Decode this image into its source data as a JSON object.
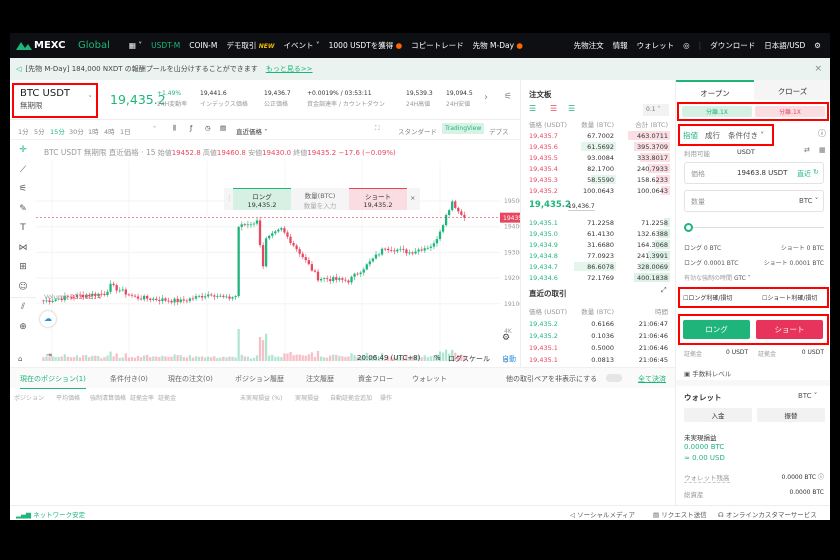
{
  "nav": {
    "logo_main": "MEXC",
    "logo_sub": "Global",
    "items": [
      "USDT-M",
      "COIN-M",
      "デモ取引",
      "イベント",
      "1000 USDTを獲得",
      "コピートレード",
      "先物 M-Day"
    ],
    "new_badge": "NEW",
    "right": [
      "先物注文",
      "情報",
      "ウォレット",
      "ダウンロード",
      "日本語/USD"
    ]
  },
  "banner": {
    "text": "[先物 M-Day] 184,000 NXDT の報酬プールを山分けすることができます",
    "link": "もっと見る>>"
  },
  "ticker": {
    "symbol": "BTC USDT",
    "type": "無期限",
    "price": "19,435.2",
    "stats": [
      {
        "v": "+1.49%",
        "l": "24H変動率"
      },
      {
        "v": "19,441.6",
        "l": "インデックス価格"
      },
      {
        "v": "19,436.7",
        "l": "公正価格"
      },
      {
        "v": "+0.0019% / 03:53:11",
        "l": "資金調達率 / カウントダウン"
      },
      {
        "v": "19,539.3",
        "l": "24H高値"
      },
      {
        "v": "19,094.5",
        "l": "24H安値"
      }
    ]
  },
  "chart": {
    "intervals": [
      "1分",
      "5分",
      "15分",
      "30分",
      "1時",
      "4時",
      "1日"
    ],
    "active_interval": "15分",
    "price_type": "直近価格",
    "views": [
      "スタンダード",
      "TradingView",
      "デプス"
    ],
    "active_view": "TradingView",
    "legend": {
      "title": "BTC USDT 無期限 直近価格 · 15",
      "open_l": "始値",
      "open": "19452.8",
      "high_l": "高値",
      "high": "19460.8",
      "low_l": "安値",
      "low": "19430.0",
      "close_l": "終値",
      "close": "19435.2",
      "change": "−17.6 (−0.09%)"
    },
    "quick_order": {
      "long": "ロング",
      "long_price": "19,435.2",
      "qty_label": "数量(BTC)",
      "qty_placeholder": "数量を入力",
      "short": "ショート",
      "short_price": "19,435.2"
    },
    "price_ticks": [
      "19500.0",
      "19400.0",
      "19300.0",
      "19200.0",
      "19100.0"
    ],
    "last_price_tag": "19435.2",
    "volume_label": "Volume",
    "volume_value": "233.8574",
    "volume_ticks": [
      "4K",
      "0"
    ],
    "time_ticks": [
      ":00",
      "18:00",
      "17",
      "06:00",
      "12:00",
      "18:00",
      "22:00"
    ],
    "price_path": [
      [
        0,
        19110
      ],
      [
        10,
        19130
      ],
      [
        20,
        19140
      ],
      [
        22,
        19170
      ],
      [
        30,
        19125
      ],
      [
        45,
        19110
      ],
      [
        55,
        19140
      ],
      [
        60,
        19120
      ],
      [
        63,
        19130
      ],
      [
        64,
        19400
      ],
      [
        70,
        19420
      ],
      [
        72,
        19250
      ],
      [
        73,
        19350
      ],
      [
        78,
        19390
      ],
      [
        84,
        19300
      ],
      [
        90,
        19200
      ],
      [
        100,
        19190
      ],
      [
        106,
        19250
      ],
      [
        112,
        19320
      ],
      [
        120,
        19300
      ],
      [
        128,
        19330
      ],
      [
        134,
        19500
      ],
      [
        136,
        19460
      ],
      [
        138,
        19435.2
      ]
    ],
    "clock": "20:06:49 (UTC+8)",
    "pct": "%",
    "log": "ログスケール",
    "auto": "自動"
  },
  "positions": {
    "tabs": [
      "現在のポジション(1)",
      "条件付き(0)",
      "現在の注文(0)",
      "ポジション履歴",
      "注文履歴",
      "資金フロー",
      "ウォレット"
    ],
    "hide_pairs": "他の取引ペアを非表示にする",
    "close_all": "全て決済",
    "columns": [
      "ポジション",
      "平均価格",
      "強制清算価格",
      "証拠金率",
      "証拠金",
      "未実現損益 (%)",
      "実現損益",
      "自動証拠金追加",
      "操作"
    ]
  },
  "orderbook": {
    "title": "注文板",
    "precision": "0.1",
    "headers": [
      "価格 (USDT)",
      "数量 (BTC)",
      "合計 (BTC)"
    ],
    "asks": [
      [
        "19,435.7",
        "67.7002",
        "463.0711"
      ],
      [
        "19,435.6",
        "61.5692",
        "395.3709"
      ],
      [
        "19,435.5",
        "93.0084",
        "333.8017"
      ],
      [
        "19,435.4",
        "82.1700",
        "240.7933"
      ],
      [
        "19,435.3",
        "58.5590",
        "158.6233"
      ],
      [
        "19,435.2",
        "100.0643",
        "100.0643"
      ]
    ],
    "mid": "19,435.2",
    "mark": "19,436.7",
    "bids": [
      [
        "19,435.1",
        "71.2258",
        "71.2258"
      ],
      [
        "19,435.0",
        "61.4130",
        "132.6388"
      ],
      [
        "19,434.9",
        "31.6680",
        "164.3068"
      ],
      [
        "19,434.8",
        "77.0923",
        "241.3991"
      ],
      [
        "19,434.7",
        "86.6078",
        "328.0069"
      ],
      [
        "19,434.6",
        "72.1769",
        "400.1838"
      ]
    ]
  },
  "trades": {
    "title": "直近の取引",
    "headers": [
      "価格 (USDT)",
      "数量 (BTC)",
      "時間"
    ],
    "rows": [
      [
        "19,435.2",
        "0.6166",
        "21:06:47",
        "buy"
      ],
      [
        "19,435.2",
        "0.1036",
        "21:06:46",
        "buy"
      ],
      [
        "19,435.1",
        "0.5000",
        "21:06:46",
        "sell"
      ],
      [
        "19,435.1",
        "0.0813",
        "21:06:45",
        "sell"
      ]
    ]
  },
  "order": {
    "tabs": [
      "オープン",
      "クローズ"
    ],
    "margin_long": "分離.1X",
    "margin_short": "分離.1X",
    "types": [
      "指値",
      "成行",
      "条件付き"
    ],
    "available_label": "利用可能",
    "available_unit": "USDT",
    "price_label": "価格",
    "price_value": "19463.8 USDT",
    "latest": "直近",
    "qty_label": "数量",
    "qty_unit": "BTC",
    "slider_pct": 0,
    "long_max": "ロング 0 BTC",
    "short_max": "ショート 0 BTC",
    "long_min": "ロング 0.0001 BTC",
    "short_min": "ショート 0.0001 BTC",
    "tif_label": "有効な強制の時間",
    "tif": "GTC",
    "tp_long": "ロング利確/損切",
    "tp_short": "ショート利確/損切",
    "long_btn": "ロング",
    "short_btn": "ショート",
    "margin_label": "証拠金",
    "margin_long_val": "0 USDT",
    "margin_short_val": "0 USDT",
    "fee_level": "手数料レベル"
  },
  "wallet": {
    "title": "ウォレット",
    "unit": "BTC",
    "deposit": "入金",
    "transfer": "振替",
    "unrealized_label": "未実現損益",
    "unrealized_btc": "0.0000 BTC",
    "unrealized_usd": "≈ 0.00 USD",
    "balance_label": "ウォレット残高",
    "balance": "0.0000 BTC",
    "total_label": "総資産",
    "total": "0.0000 BTC"
  },
  "footer": {
    "network": "ネットワーク安定",
    "social": "ソーシャルメディア",
    "request": "リクエスト送信",
    "support": "オンラインカスタマーサービス"
  },
  "colors": {
    "up": "#1fb57a",
    "down": "#e8475f",
    "highlight": "#ff0000"
  }
}
